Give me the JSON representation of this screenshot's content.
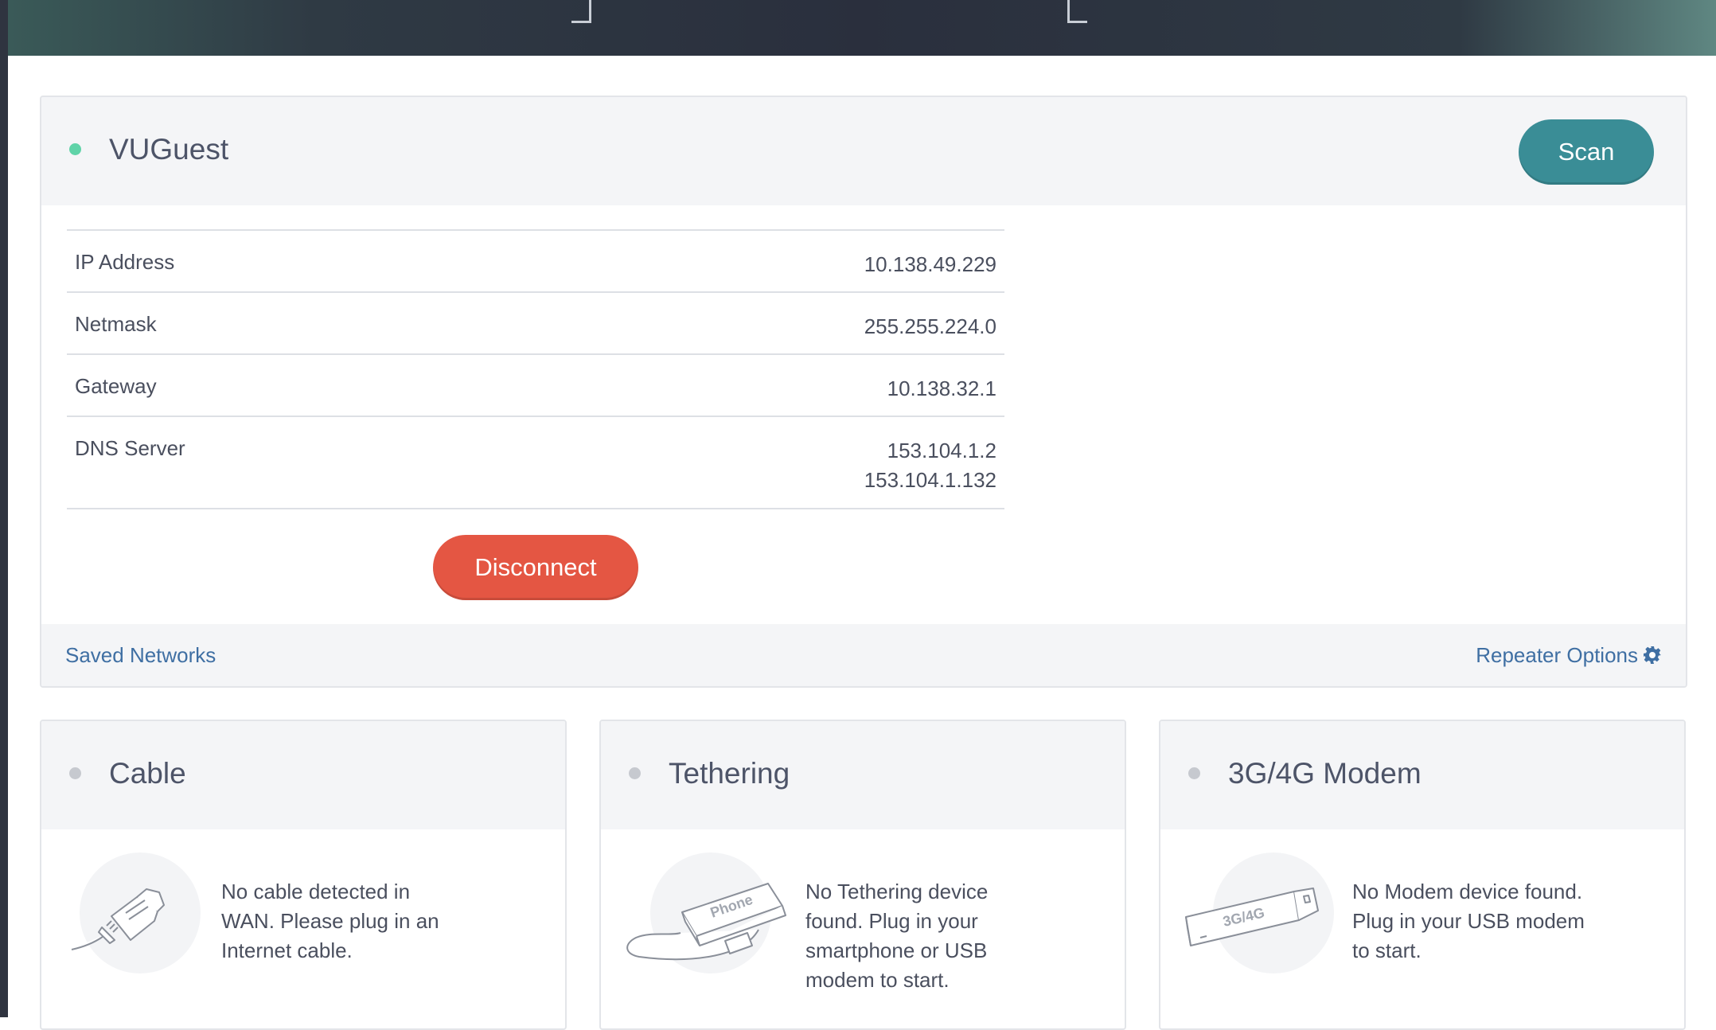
{
  "colors": {
    "connected": "#5fd3a8",
    "disconnected": "#c6c9cf",
    "scan_button": "#3a8d96",
    "disconnect_button": "#e45643",
    "link": "#3f6fa3"
  },
  "wifi": {
    "network_name": "VUGuest",
    "status": "connected",
    "scan_label": "Scan",
    "rows": [
      {
        "label": "IP Address",
        "values": [
          "10.138.49.229"
        ]
      },
      {
        "label": "Netmask",
        "values": [
          "255.255.224.0"
        ]
      },
      {
        "label": "Gateway",
        "values": [
          "10.138.32.1"
        ]
      },
      {
        "label": "DNS Server",
        "values": [
          "153.104.1.2",
          "153.104.1.132"
        ]
      }
    ],
    "disconnect_label": "Disconnect",
    "saved_networks_label": "Saved Networks",
    "repeater_options_label": "Repeater Options",
    "repeater_icon": "gear-icon"
  },
  "cable": {
    "title": "Cable",
    "status": "disconnected",
    "icon": "ethernet-cable-icon",
    "lines": [
      "No cable detected in",
      "WAN. Please plug in an",
      "Internet cable."
    ]
  },
  "tethering": {
    "title": "Tethering",
    "status": "disconnected",
    "icon": "phone-icon",
    "phone_label": "Phone",
    "lines": [
      "No Tethering device",
      "found. Plug in your",
      "smartphone or USB",
      "modem to start."
    ]
  },
  "modem": {
    "title": "3G/4G Modem",
    "status": "disconnected",
    "icon": "usb-modem-icon",
    "modem_label": "3G/4G",
    "lines": [
      "No Modem device found.",
      "Plug in your USB modem",
      "to start."
    ]
  }
}
